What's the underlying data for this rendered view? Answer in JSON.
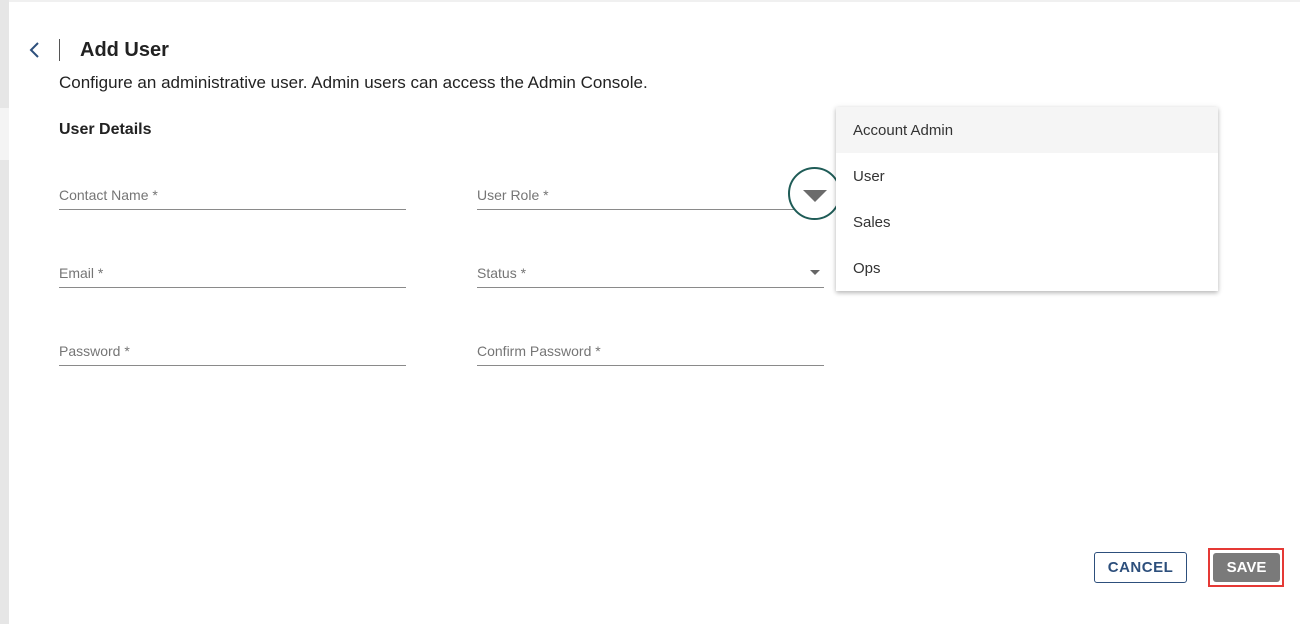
{
  "header": {
    "back_icon": "chevron-left-icon",
    "title": "Add User"
  },
  "subtitle": "Configure an administrative user. Admin users can access the Admin Console.",
  "section_title": "User Details",
  "form": {
    "contact_name": {
      "label": "Contact Name *",
      "value": ""
    },
    "user_role": {
      "label": "User Role *",
      "value": ""
    },
    "email": {
      "label": "Email *",
      "value": ""
    },
    "status": {
      "label": "Status *",
      "value": ""
    },
    "password": {
      "label": "Password *",
      "value": ""
    },
    "confirm_password": {
      "label": "Confirm Password *",
      "value": ""
    }
  },
  "role_menu": {
    "items": [
      {
        "label": "Account Admin"
      },
      {
        "label": "User"
      },
      {
        "label": "Sales"
      },
      {
        "label": "Ops"
      }
    ],
    "highlighted_index": 0
  },
  "actions": {
    "cancel_label": "CANCEL",
    "save_label": "SAVE"
  },
  "colors": {
    "primary": "#2d4f7c",
    "save_bg": "#7a7a7a",
    "highlight": "#e53935",
    "toggle_ring": "#1f5c57"
  }
}
